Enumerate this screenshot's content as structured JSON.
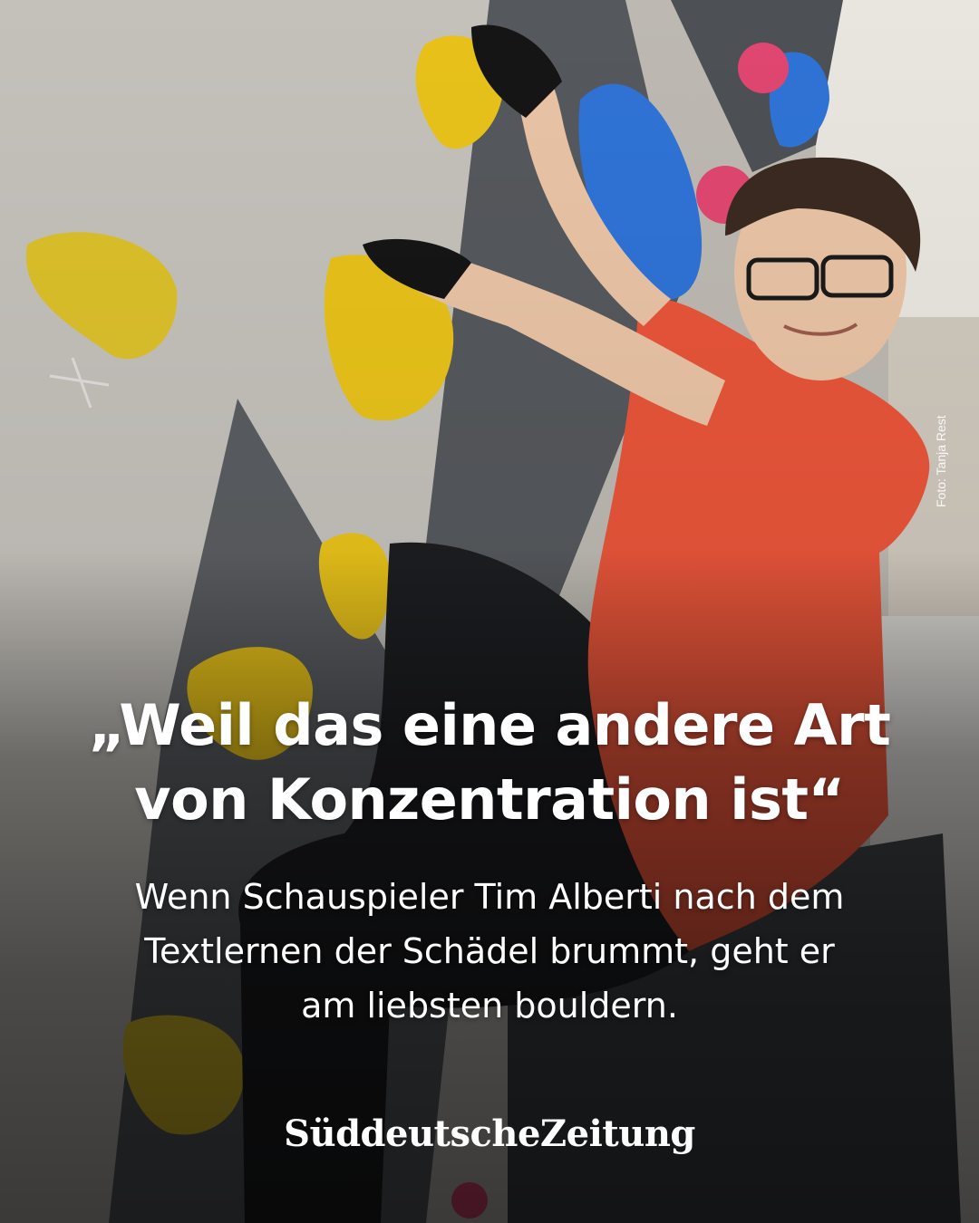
{
  "post": {
    "headline_line1": "„Weil das eine andere Art",
    "headline_line2": "von Konzentration ist“",
    "subline_line1": "Wenn Schauspieler Tim Alberti nach dem",
    "subline_line2": "Textlernen der Schädel brummt, geht er",
    "subline_line3": "am liebsten bouldern.",
    "photo_credit": "Foto: Tanja Rest",
    "brand": "SüddeutscheZeitung"
  },
  "colors": {
    "text": "#ffffff",
    "shirt": "#e8553a",
    "hold_yellow": "#e8c21a",
    "hold_blue": "#2f73d6",
    "hold_pink": "#e04670",
    "wall_gray": "#bdb9b2",
    "panel_dark": "#55585c"
  }
}
